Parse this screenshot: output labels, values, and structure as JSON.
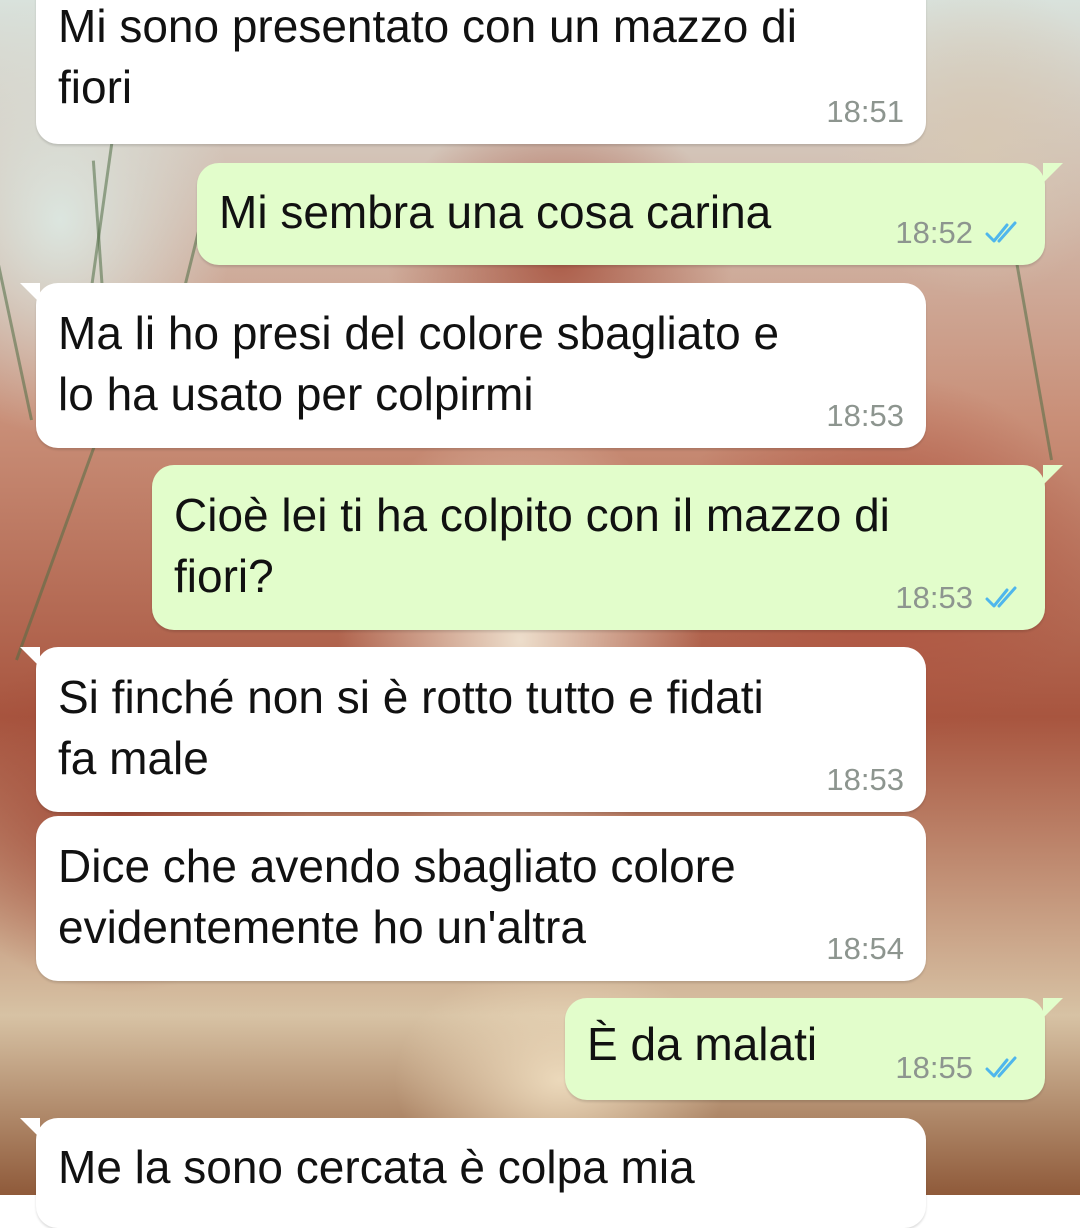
{
  "colors": {
    "incoming_bubble": "#ffffff",
    "outgoing_bubble": "#e2fdcb",
    "timestamp": "#8d958f",
    "read_ticks": "#4fb6ec"
  },
  "messages": [
    {
      "direction": "incoming",
      "text": "Mi sono presentato con un mazzo di\nfiori",
      "time": "18:51"
    },
    {
      "direction": "outgoing",
      "text": "Mi sembra una cosa carina",
      "time": "18:52",
      "status_icon": "double-check-read-icon"
    },
    {
      "direction": "incoming",
      "text": "Ma li ho presi del colore sbagliato e\nlo ha usato per colpirmi",
      "time": "18:53"
    },
    {
      "direction": "outgoing",
      "text": "Cioè lei ti ha colpito con il mazzo di\nfiori?",
      "time": "18:53",
      "status_icon": "double-check-read-icon"
    },
    {
      "direction": "incoming",
      "text": "Si finché non si è rotto tutto e fidati\nfa male",
      "time": "18:53"
    },
    {
      "direction": "incoming",
      "text": "Dice che avendo sbagliato colore\nevidentemente ho un'altra",
      "time": "18:54"
    },
    {
      "direction": "outgoing",
      "text": "È da malati",
      "time": "18:55",
      "status_icon": "double-check-read-icon"
    },
    {
      "direction": "incoming",
      "text": "Me la sono cercata è colpa mia",
      "time": ""
    }
  ]
}
